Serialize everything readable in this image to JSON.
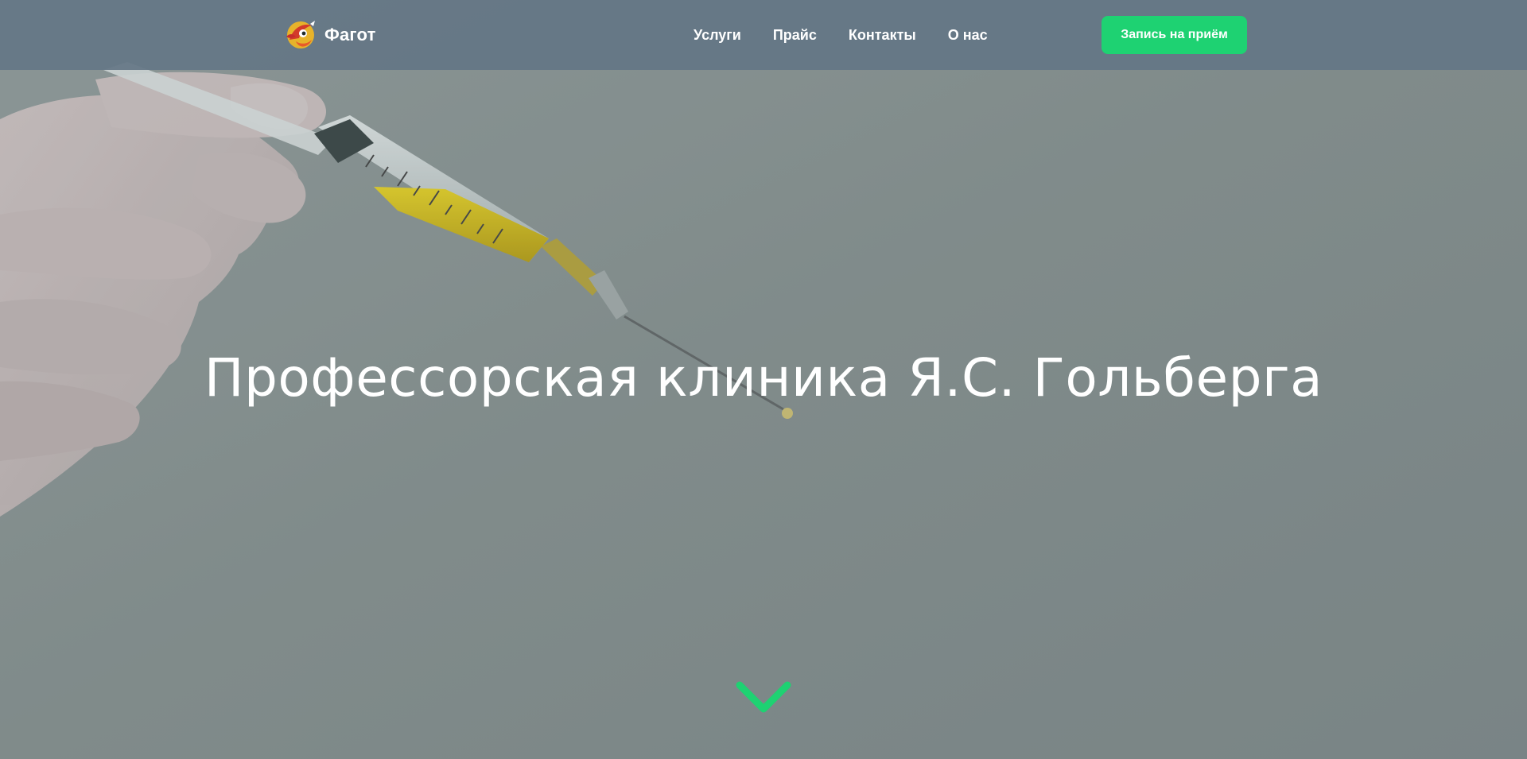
{
  "header": {
    "logo_text": "Фагот",
    "logo_icon": "bassoon-bird-logo-icon",
    "nav": [
      {
        "label": "Услуги"
      },
      {
        "label": "Прайс"
      },
      {
        "label": "Контакты"
      },
      {
        "label": "О нас"
      }
    ],
    "cta_label": "Запись на приём"
  },
  "hero": {
    "title": "Профессорская клиника Я.С. Гольберга",
    "background_image": "gloved-hand-holding-syringe-with-yellow-liquid",
    "scroll_icon": "chevron-down-icon"
  },
  "colors": {
    "header_bg": "#647686",
    "accent": "#1ed272",
    "text": "#ffffff"
  }
}
